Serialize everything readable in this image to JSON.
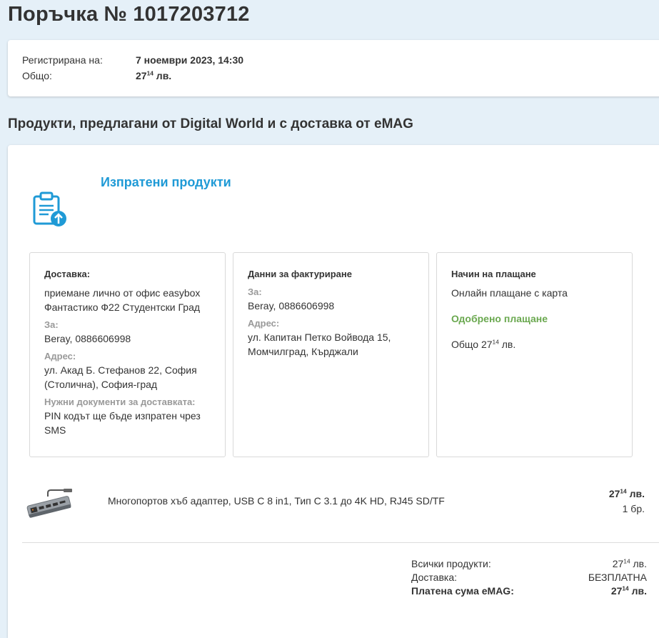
{
  "order": {
    "title": "Поръчка № 1017203712",
    "registered_label": "Регистрирана на:",
    "registered_value": "7 ноември 2023, 14:30",
    "total_label": "Общо:",
    "total_int": "27",
    "total_dec": "14",
    "total_cur": " лв."
  },
  "seller_section": {
    "title": "Продукти, предлагани от Digital World и с доставка от eMAG",
    "status_title": "Изпратени продукти",
    "status_icon": "clipboard-upload-icon"
  },
  "delivery": {
    "heading": "Доставка:",
    "method": "приемане лично от офис easybox Фантастико Ф22 Студентски Град",
    "for_label": "За:",
    "for_value": "Beray, 0886606998",
    "address_label": "Адрес:",
    "address_value": "ул. Акад Б. Стефанов 22, София (Столична), София-град",
    "docs_label": "Нужни документи за доставката:",
    "docs_value": "PIN кодът ще бъде изпратен чрез SMS"
  },
  "billing": {
    "heading": "Данни за фактуриране",
    "for_label": "За:",
    "for_value": "Beray, 0886606998",
    "address_label": "Адрес:",
    "address_value": "ул. Капитан Петко Войвода 15, Момчилград, Кърджали"
  },
  "payment": {
    "heading": "Начин на плащане",
    "method": "Онлайн плащане с карта",
    "status": "Одобрено плащане",
    "status_color": "#6aa84f",
    "total_prefix": "Общо 27",
    "total_dec": "14",
    "total_cur": " лв."
  },
  "product": {
    "name": "Многопортов хъб адаптер, USB C 8 in1, Тип C 3.1 до 4K HD, RJ45 SD/TF",
    "price_int": "27",
    "price_dec": "14",
    "price_cur": " лв.",
    "qty": "1 бр."
  },
  "totals": {
    "all_label": "Всички продукти:",
    "all_int": "27",
    "all_dec": "14",
    "all_cur": " лв.",
    "delivery_label": "Доставка:",
    "delivery_value": "БЕЗПЛАТНА",
    "paid_label": "Платена сума eMAG:",
    "paid_int": "27",
    "paid_dec": "14",
    "paid_cur": " лв."
  },
  "colors": {
    "accent": "#1f9ad6",
    "background": "#e5f0f8"
  }
}
